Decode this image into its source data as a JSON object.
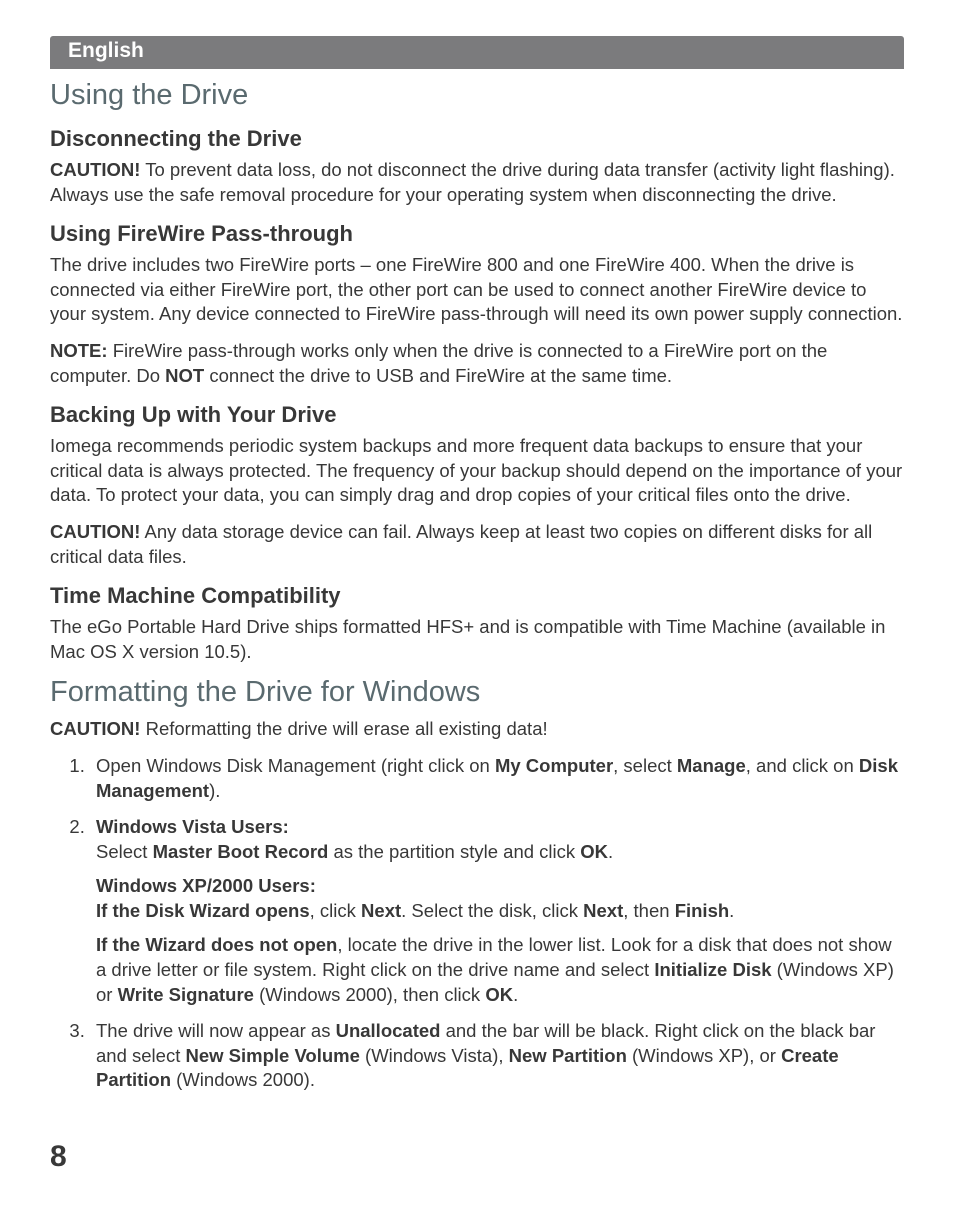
{
  "lang_bar": "English",
  "section1": {
    "title": "Using the Drive",
    "sub1": {
      "heading": "Disconnecting the Drive",
      "caution_label": "CAUTION!",
      "caution_text": " To prevent data loss, do not disconnect the drive during data transfer (activity light flashing). Always use the safe removal procedure for your operating system when disconnecting the drive."
    },
    "sub2": {
      "heading": "Using FireWire Pass-through",
      "p1": "The drive includes two FireWire ports – one FireWire 800 and one FireWire 400. When the drive is connected via either FireWire port, the other port can be used to connect another FireWire device to your system. Any device connected to FireWire pass-through will need its own power supply connection.",
      "note_label": "NOTE:",
      "note_text": " FireWire pass-through works only when the drive is connected to a FireWire port on the computer. Do ",
      "note_not": "NOT",
      "note_tail": " connect the drive to USB and FireWire at the same time."
    },
    "sub3": {
      "heading": "Backing Up with Your Drive",
      "p1": "Iomega recommends periodic system backups and more frequent data backups to ensure that your critical data is always protected.  The frequency of your backup should depend on the importance of your data. To protect your data, you can simply drag and drop copies of your critical files onto the drive.",
      "caution_label": "CAUTION!",
      "caution_text": " Any data storage device can fail. Always keep at least two copies on different disks for all critical data files."
    },
    "sub4": {
      "heading": "Time Machine Compatibility",
      "p1": "The eGo Portable Hard Drive ships formatted HFS+ and is compatible with Time Machine (available in Mac OS X version 10.5)."
    }
  },
  "section2": {
    "title": "Formatting the Drive for Windows",
    "caution_label": "CAUTION!",
    "caution_text": " Reformatting the drive will erase all existing data!",
    "steps": {
      "s1": {
        "a": "Open Windows Disk Management (right click on ",
        "b": "My Computer",
        "c": ", select ",
        "d": "Manage",
        "e": ", and click on ",
        "f": "Disk Management",
        "g": ")."
      },
      "s2": {
        "vista_label": "Windows Vista Users:",
        "vista_a": "Select ",
        "vista_b": "Master Boot Record",
        "vista_c": " as the partition style and click ",
        "vista_d": "OK",
        "vista_e": ".",
        "xp_label": "Windows XP/2000 Users:",
        "xp_opens_a": "If the Disk Wizard opens",
        "xp_opens_b": ", click ",
        "xp_opens_c": "Next",
        "xp_opens_d": ". Select the disk, click ",
        "xp_opens_e": "Next",
        "xp_opens_f": ", then ",
        "xp_opens_g": "Finish",
        "xp_opens_h": ".",
        "xp_noopen_a": "If the Wizard does not open",
        "xp_noopen_b": ", locate the drive in the lower list. Look for a disk that does not show a drive letter or file system. Right click on the drive name and select ",
        "xp_noopen_c": "Initialize Disk",
        "xp_noopen_d": " (Windows XP) or ",
        "xp_noopen_e": "Write Signature",
        "xp_noopen_f": " (Windows 2000), then click ",
        "xp_noopen_g": "OK",
        "xp_noopen_h": "."
      },
      "s3": {
        "a": "The drive will now appear as ",
        "b": "Unallocated",
        "c": " and the bar will be black. Right click on the black bar and select ",
        "d": "New Simple Volume",
        "e": " (Windows Vista), ",
        "f": "New Partition",
        "g": " (Windows XP), or ",
        "h": "Create Partition",
        "i": " (Windows 2000)."
      }
    }
  },
  "page_number": "8"
}
